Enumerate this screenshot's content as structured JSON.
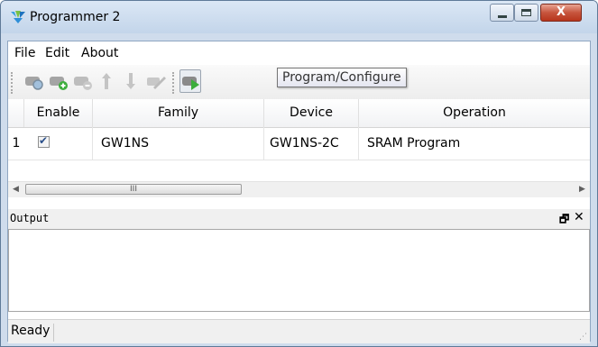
{
  "window": {
    "title": "Programmer 2",
    "close_glyph": "X"
  },
  "menu": {
    "items": [
      "File",
      "Edit",
      "About"
    ]
  },
  "toolbar": {
    "buttons": [
      "scan-icon",
      "add-device-icon",
      "remove-device-icon",
      "move-up-icon",
      "move-down-icon",
      "edit-icon",
      "program-configure-icon"
    ],
    "tooltip": "Program/Configure"
  },
  "table": {
    "columns": [
      "Enable",
      "Family",
      "Device",
      "Operation"
    ],
    "rows": [
      {
        "index": "1",
        "enabled": true,
        "family": "GW1NS",
        "device": "GW1NS-2C",
        "operation": "SRAM Program"
      }
    ]
  },
  "scrollbar": {
    "thumb_grip": "III"
  },
  "output": {
    "title": "Output",
    "float_glyph": "🗗",
    "close_glyph": "✕"
  },
  "status": {
    "text": "Ready"
  }
}
